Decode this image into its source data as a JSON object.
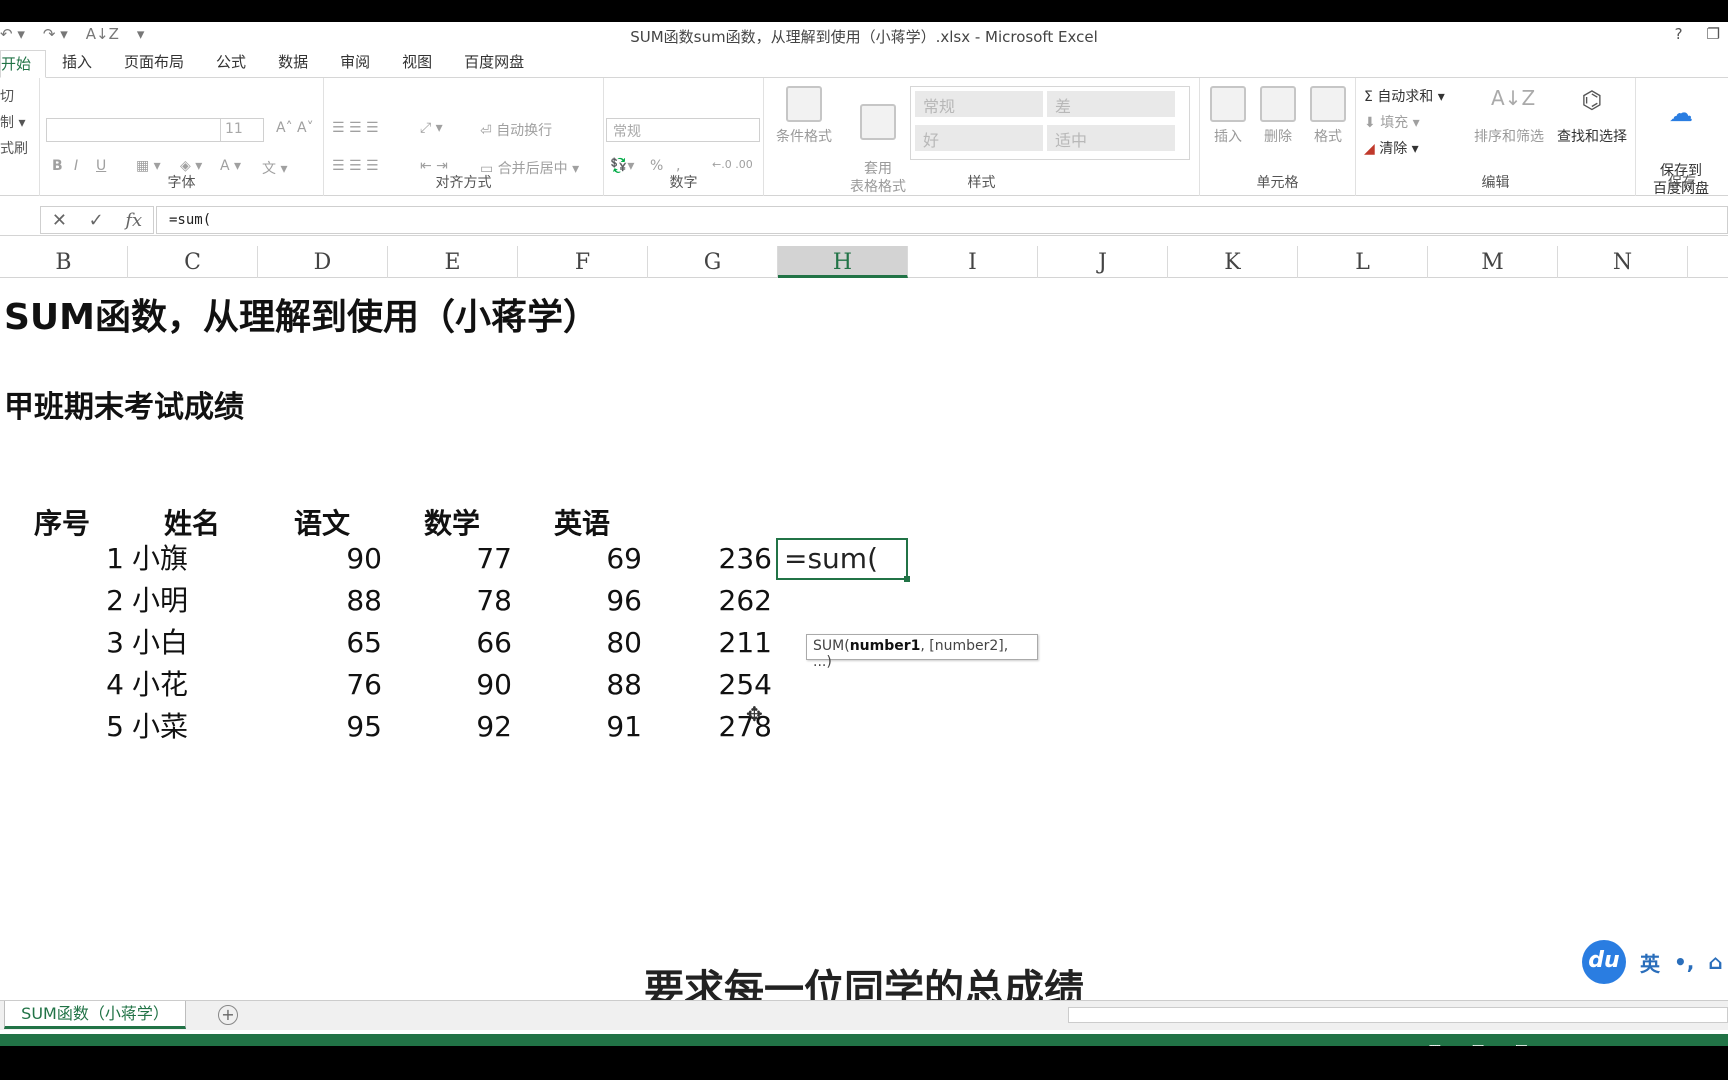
{
  "window": {
    "title": "SUM函数sum函数，从理解到使用（小蒋学）.xlsx - Microsoft Excel",
    "help": "?",
    "restore": "❐"
  },
  "qat": {
    "undo": "↶ ▾",
    "redo": "↷ ▾",
    "sort": "A↓Z",
    "more": "▾"
  },
  "tabs": [
    {
      "label": "开始",
      "active": true
    },
    {
      "label": "插入"
    },
    {
      "label": "页面布局"
    },
    {
      "label": "公式"
    },
    {
      "label": "数据"
    },
    {
      "label": "审阅"
    },
    {
      "label": "视图"
    },
    {
      "label": "百度网盘"
    }
  ],
  "ribbon": {
    "clipboard": {
      "cut": "切",
      "copy": "制 ▾",
      "format_painter": "式刷"
    },
    "font": {
      "label": "字体",
      "size": "11",
      "bold": "B",
      "italic": "I",
      "underline": "U"
    },
    "alignment": {
      "label": "对齐方式",
      "wrap": "自动换行",
      "merge": "合并后居中"
    },
    "number": {
      "label": "数字",
      "format": "常规",
      "percent": "%",
      "comma": ","
    },
    "styles": {
      "label": "样式",
      "conditional": "条件格式",
      "table_fmt": "套用\n表格格式",
      "normal": "常规",
      "bad": "差",
      "good": "好",
      "neutral": "适中"
    },
    "cells": {
      "label": "单元格",
      "insert": "插入",
      "delete": "删除",
      "format": "格式"
    },
    "editing": {
      "label": "编辑",
      "autosum": "自动求和",
      "fill": "填充",
      "clear": "清除",
      "sort_filter": "排序和筛选",
      "find_select": "查找和选择"
    },
    "save": {
      "label": "保存",
      "save_baidu": "保存到\n百度网盘"
    }
  },
  "formula_bar": {
    "value": "=sum(",
    "cancel": "✕",
    "enter": "✓",
    "fx": "fx"
  },
  "columns": [
    "B",
    "C",
    "D",
    "E",
    "F",
    "G",
    "H",
    "I",
    "J",
    "K",
    "L",
    "M",
    "N"
  ],
  "selected_column": "H",
  "sheet": {
    "title": "SUM函数，从理解到使用（小蒋学）",
    "subtitle": "甲班期末考试成绩",
    "headers": [
      "序号",
      "姓名",
      "语文",
      "数学",
      "英语"
    ],
    "rows": [
      {
        "no": "1",
        "name": "小旗",
        "chinese": "90",
        "math": "77",
        "english": "69",
        "total": "236"
      },
      {
        "no": "2",
        "name": "小明",
        "chinese": "88",
        "math": "78",
        "english": "96",
        "total": "262"
      },
      {
        "no": "3",
        "name": "小白",
        "chinese": "65",
        "math": "66",
        "english": "80",
        "total": "211"
      },
      {
        "no": "4",
        "name": "小花",
        "chinese": "76",
        "math": "90",
        "english": "88",
        "total": "254"
      },
      {
        "no": "5",
        "name": "小菜",
        "chinese": "95",
        "math": "92",
        "english": "91",
        "total": "278"
      }
    ],
    "active_cell_value": "=sum(",
    "tooltip": {
      "prefix": "SUM(",
      "arg1": "number1",
      "rest": ", [number2], ...)"
    }
  },
  "caption": "要求每一位同学的总成绩",
  "ime": {
    "logo": "du",
    "lang": "英",
    "punct": "•,",
    "tools": "⌂"
  },
  "sheet_tab": {
    "name": "SUM函数（小蒋学）",
    "add": "+"
  },
  "status": {
    "view1": "▦",
    "view2": "▣",
    "view3": "▤"
  },
  "colors": {
    "accent": "#217346",
    "status_bar": "#217346"
  }
}
